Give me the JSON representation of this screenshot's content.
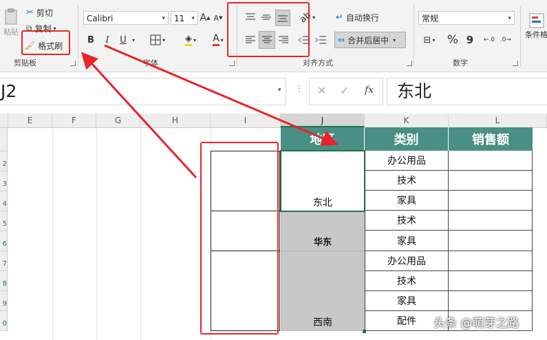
{
  "ribbon": {
    "clipboard": {
      "paste_label": "粘贴",
      "cut_label": "剪切",
      "copy_label": "复制",
      "format_painter_label": "格式刷",
      "group_label": "剪贴板"
    },
    "font": {
      "name": "Calibri",
      "size": "11",
      "bold": "B",
      "italic": "I",
      "underline": "U",
      "grow": "A",
      "shrink": "A",
      "font_color": "A",
      "group_label": "字体"
    },
    "alignment": {
      "wrap_text_label": "自动换行",
      "merge_center_label": "合并后居中",
      "group_label": "对齐方式"
    },
    "number": {
      "format": "常规",
      "percent": "%",
      "comma": "9",
      "group_label": "数字"
    },
    "styles": {
      "conditional_label": "条件格"
    }
  },
  "formula_bar": {
    "name_box": "J2",
    "formula": "东北",
    "fx": "fx"
  },
  "columns": [
    "E",
    "F",
    "G",
    "H",
    "I",
    "J",
    "K",
    "L"
  ],
  "row_numbers": [
    "2",
    "3",
    "4",
    "5",
    "6",
    "7",
    "8",
    "9",
    "0"
  ],
  "table": {
    "headers": [
      "地区",
      "类别",
      "销售额"
    ],
    "regions": [
      "东北",
      "华东",
      "西南"
    ],
    "categories": [
      "办公用品",
      "技术",
      "家具",
      "技术",
      "家具",
      "办公用品",
      "技术",
      "家具",
      "配件"
    ]
  },
  "watermark": "头条 @萌芽之路",
  "colors": {
    "header_fill": "#4a8f84",
    "gray_fill": "#c8c8c8",
    "highlight": "#e8232a"
  }
}
